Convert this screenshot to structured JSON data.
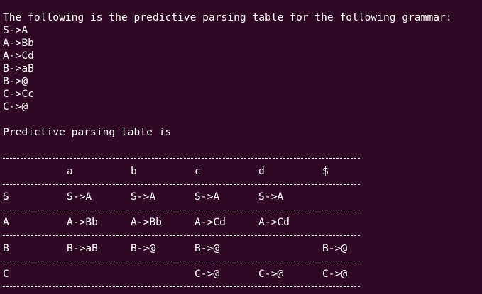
{
  "intro": "The following is the predictive parsing table for the following grammar:",
  "grammar": [
    "S->A",
    "A->Bb",
    "A->Cd",
    "B->aB",
    "B->@",
    "C->Cc",
    "C->@"
  ],
  "table_title": "Predictive parsing table is",
  "table": {
    "header": [
      "",
      "a",
      "b",
      "c",
      "d",
      "$"
    ],
    "rows": [
      [
        "S",
        "S->A",
        "S->A",
        "S->A",
        "S->A",
        ""
      ],
      [
        "A",
        "A->Bb",
        "A->Bb",
        "A->Cd",
        "A->Cd",
        ""
      ],
      [
        "B",
        "B->aB",
        "B->@",
        "B->@",
        "",
        "B->@"
      ],
      [
        "C",
        "",
        "",
        "C->@",
        "C->@",
        "C->@"
      ]
    ]
  }
}
